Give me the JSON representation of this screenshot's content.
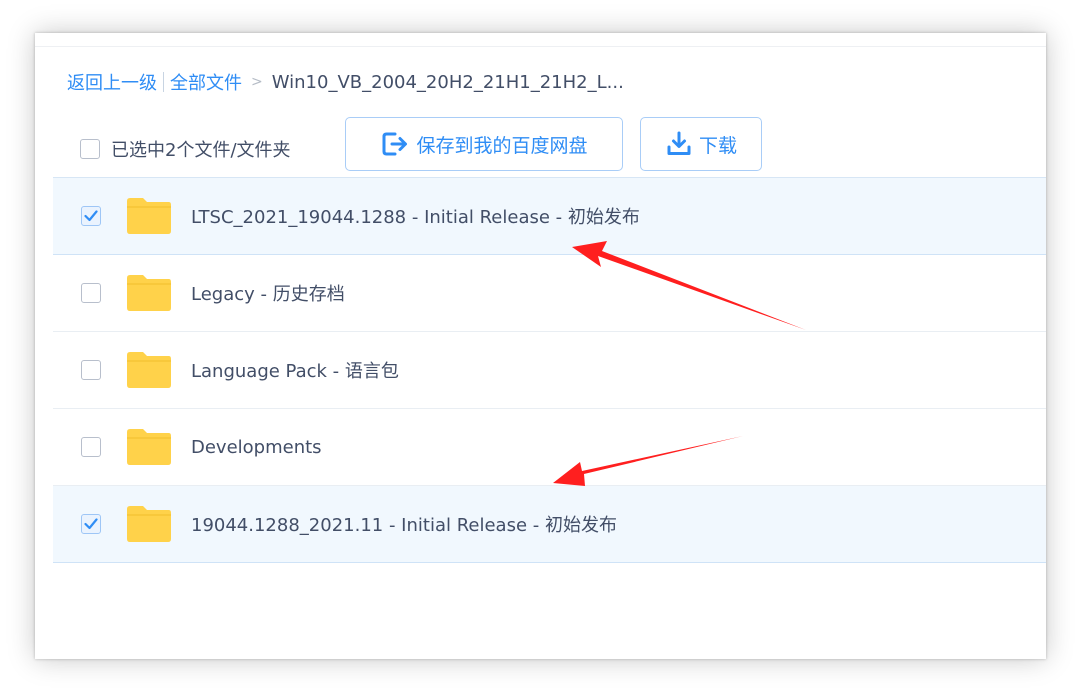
{
  "breadcrumb": {
    "back": "返回上一级",
    "all_files": "全部文件",
    "separator": ">",
    "current": "Win10_VB_2004_20H2_21H1_21H2_L..."
  },
  "toolbar": {
    "select_label": "已选中2个文件/文件夹",
    "save_label": "保存到我的百度网盘",
    "download_label": "下载"
  },
  "rows": [
    {
      "name": "LTSC_2021_19044.1288 - Initial Release - 初始发布",
      "checked": true
    },
    {
      "name": "Legacy - 历史存档",
      "checked": false
    },
    {
      "name": "Language Pack - 语言包",
      "checked": false
    },
    {
      "name": "Developments",
      "checked": false
    },
    {
      "name": "19044.1288_2021.11 - Initial Release - 初始发布",
      "checked": true
    }
  ],
  "colors": {
    "accent": "#2f8df5",
    "folder": "#ffd24a",
    "selected_row": "#f1f8fe",
    "annotation_arrow": "#ff1f1f"
  }
}
